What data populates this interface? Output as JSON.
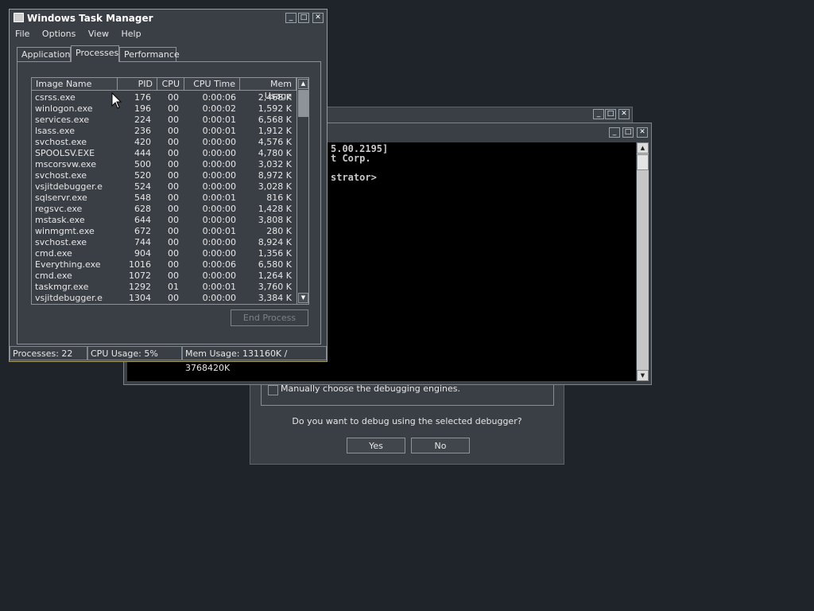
{
  "debugger_dialog": {
    "checkbox_label": "Manually choose the debugging engines.",
    "question": "Do you want to debug using the selected debugger?",
    "yes_label": "Yes",
    "no_label": "No"
  },
  "cmd_window": {
    "lines": [
      "5.00.2195]",
      "t Corp.",
      "",
      "strator>"
    ]
  },
  "task_manager": {
    "title": "Windows Task Manager",
    "menu": [
      "File",
      "Options",
      "View",
      "Help"
    ],
    "tabs": [
      "Applications",
      "Processes",
      "Performance"
    ],
    "active_tab": "Processes",
    "columns": [
      "Image Name",
      "PID",
      "CPU",
      "CPU Time",
      "Mem Usage"
    ],
    "processes": [
      {
        "name": "csrss.exe",
        "pid": "176",
        "cpu": "00",
        "time": "0:00:06",
        "mem": "2,468 K"
      },
      {
        "name": "winlogon.exe",
        "pid": "196",
        "cpu": "00",
        "time": "0:00:02",
        "mem": "1,592 K"
      },
      {
        "name": "services.exe",
        "pid": "224",
        "cpu": "00",
        "time": "0:00:01",
        "mem": "6,568 K"
      },
      {
        "name": "lsass.exe",
        "pid": "236",
        "cpu": "00",
        "time": "0:00:01",
        "mem": "1,912 K"
      },
      {
        "name": "svchost.exe",
        "pid": "420",
        "cpu": "00",
        "time": "0:00:00",
        "mem": "4,576 K"
      },
      {
        "name": "SPOOLSV.EXE",
        "pid": "444",
        "cpu": "00",
        "time": "0:00:00",
        "mem": "4,780 K"
      },
      {
        "name": "mscorsvw.exe",
        "pid": "500",
        "cpu": "00",
        "time": "0:00:00",
        "mem": "3,032 K"
      },
      {
        "name": "svchost.exe",
        "pid": "520",
        "cpu": "00",
        "time": "0:00:00",
        "mem": "8,972 K"
      },
      {
        "name": "vsjitdebugger.e",
        "pid": "524",
        "cpu": "00",
        "time": "0:00:00",
        "mem": "3,028 K"
      },
      {
        "name": "sqlservr.exe",
        "pid": "548",
        "cpu": "00",
        "time": "0:00:01",
        "mem": "816 K"
      },
      {
        "name": "regsvc.exe",
        "pid": "628",
        "cpu": "00",
        "time": "0:00:00",
        "mem": "1,428 K"
      },
      {
        "name": "mstask.exe",
        "pid": "644",
        "cpu": "00",
        "time": "0:00:00",
        "mem": "3,808 K"
      },
      {
        "name": "winmgmt.exe",
        "pid": "672",
        "cpu": "00",
        "time": "0:00:01",
        "mem": "280 K"
      },
      {
        "name": "svchost.exe",
        "pid": "744",
        "cpu": "00",
        "time": "0:00:00",
        "mem": "8,924 K"
      },
      {
        "name": "cmd.exe",
        "pid": "904",
        "cpu": "00",
        "time": "0:00:00",
        "mem": "1,356 K"
      },
      {
        "name": "Everything.exe",
        "pid": "1016",
        "cpu": "00",
        "time": "0:00:06",
        "mem": "6,580 K"
      },
      {
        "name": "cmd.exe",
        "pid": "1072",
        "cpu": "00",
        "time": "0:00:00",
        "mem": "1,264 K"
      },
      {
        "name": "taskmgr.exe",
        "pid": "1292",
        "cpu": "01",
        "time": "0:00:01",
        "mem": "3,760 K"
      },
      {
        "name": "vsjitdebugger.e",
        "pid": "1304",
        "cpu": "00",
        "time": "0:00:00",
        "mem": "3,384 K"
      }
    ],
    "end_process_label": "End Process",
    "status": {
      "processes": "Processes: 22",
      "cpu": "CPU Usage: 5%",
      "mem": "Mem Usage: 131160K / 3768420K"
    }
  },
  "colors": {
    "desktop": "#1f242b",
    "window": "#3a3f46",
    "active_border": "#a89f5a"
  },
  "icons": [
    "minimize-icon",
    "maximize-icon",
    "close-icon",
    "task-manager-icon",
    "mouse-cursor-icon",
    "scroll-up-icon",
    "scroll-down-icon",
    "checkbox-icon"
  ]
}
